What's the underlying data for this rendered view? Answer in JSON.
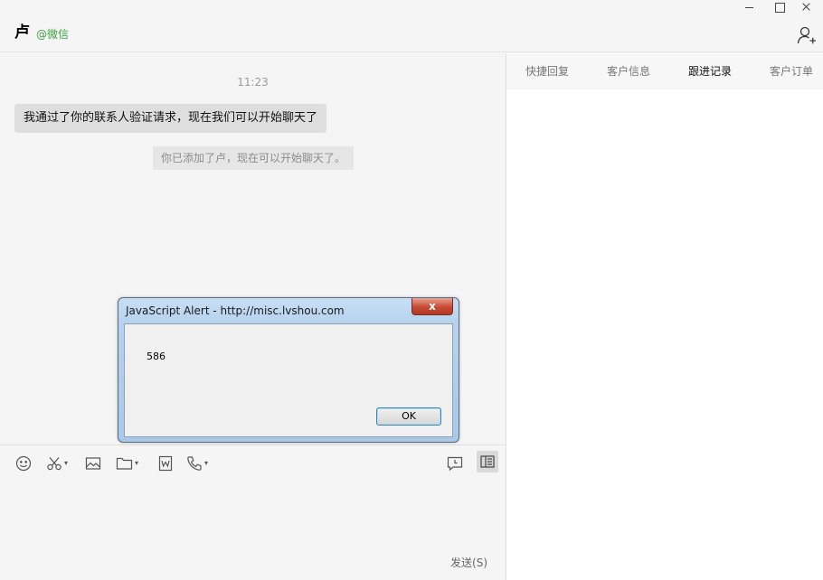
{
  "header": {
    "contact_name": "卢",
    "contact_source": "@微信",
    "add_user_icon": "add-user-icon"
  },
  "chat": {
    "timestamp": "11:23",
    "message": "我通过了你的联系人验证请求，现在我们可以开始聊天了",
    "system_notice": "你已添加了卢，现在可以开始聊天了。"
  },
  "toolbar": {
    "icons": [
      "emoji-icon",
      "screenshot-scissors-icon",
      "image-icon",
      "folder-icon",
      "word-doc-icon",
      "phone-icon",
      "chat-history-icon",
      "side-panel-icon"
    ]
  },
  "input": {
    "send_label": "发送(S)"
  },
  "right_panel": {
    "tabs": [
      {
        "label": "快捷回复",
        "active": false
      },
      {
        "label": "客户信息",
        "active": false
      },
      {
        "label": "跟进记录",
        "active": true
      },
      {
        "label": "客户订单",
        "active": false
      }
    ]
  },
  "alert": {
    "title": "JavaScript Alert - http://misc.lvshou.com",
    "close_label": "x",
    "message": "586",
    "ok_label": "OK"
  },
  "colors": {
    "source_green": "#3fa13f",
    "background": "#f5f5f5",
    "bubble": "#dedede",
    "alert_close_red": "#c64a34"
  }
}
